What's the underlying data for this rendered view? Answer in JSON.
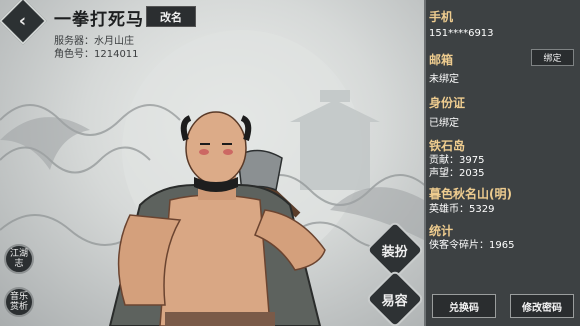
{
  "header": {
    "player_name": "一拳打死马",
    "rename_label": "改名",
    "server_line": "服务器：水月山庄",
    "role_line": "角色号：1214011"
  },
  "side_buttons": [
    {
      "label": "江湖志"
    },
    {
      "label": "音乐赏析"
    }
  ],
  "actions": {
    "dress": "装扮",
    "appearance": "易容"
  },
  "account": {
    "phone_title": "手机",
    "phone_value": "151****6913",
    "email_title": "邮箱",
    "email_value": "未绑定",
    "bind_label": "绑定",
    "id_title": "身份证",
    "id_value": "已绑定",
    "tieshi_title": "铁石岛",
    "tieshi_contrib": "贡献：3975",
    "tieshi_fame": "声望：2035",
    "qiuming_title": "暮色秋名山(明)",
    "qiuming_coin": "英雄币：5329",
    "stats_title": "统计",
    "stats_shards": "侠客令碎片：1965",
    "redeem_label": "兑换码",
    "change_pw_label": "修改密码"
  },
  "icons": {
    "back": "diamond-arrow-icon",
    "accent": "#eecc8f",
    "panel_bg": "#3d4143"
  }
}
